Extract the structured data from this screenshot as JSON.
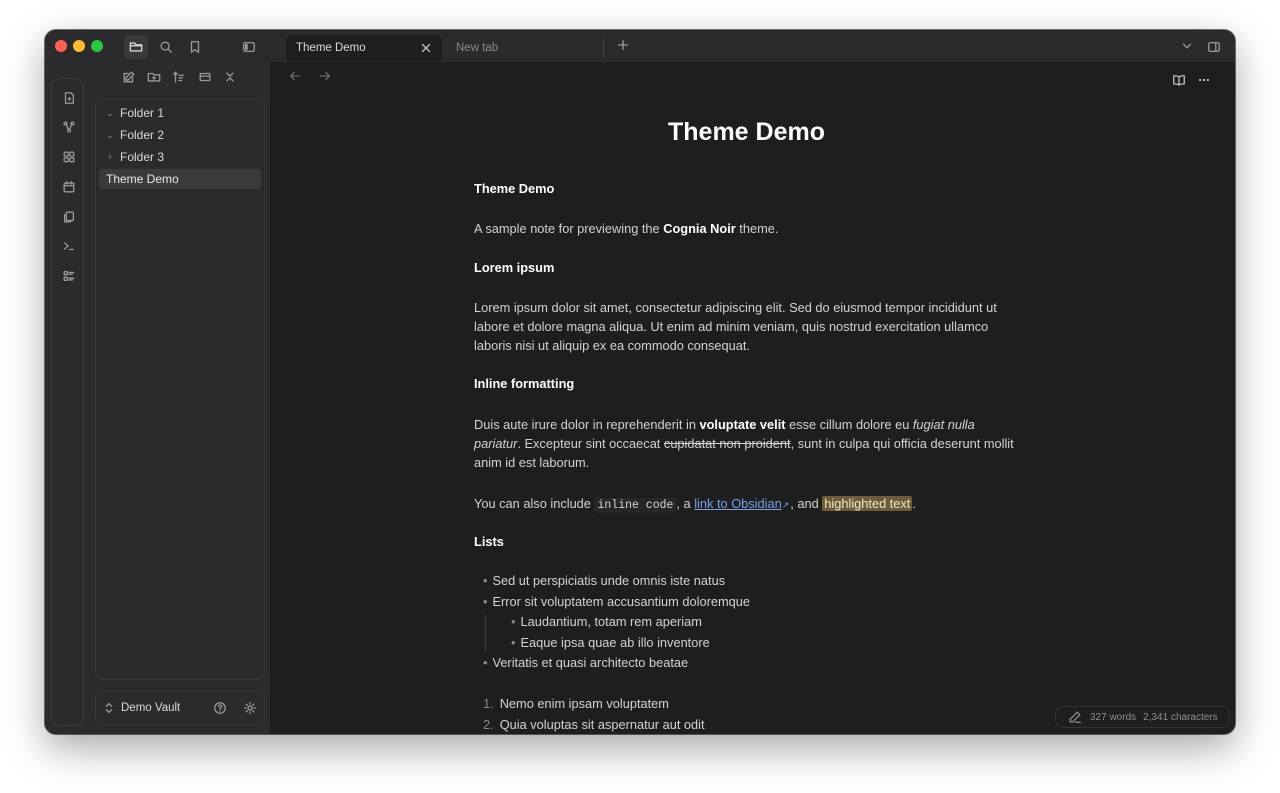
{
  "tabs": [
    {
      "label": "Theme Demo",
      "active": true
    },
    {
      "label": "New tab",
      "active": false
    }
  ],
  "file_tree": {
    "items": [
      {
        "label": "Folder 1",
        "type": "folder",
        "expanded": true
      },
      {
        "label": "Folder 2",
        "type": "folder",
        "expanded": true
      },
      {
        "label": "Folder 3",
        "type": "folder",
        "expanded": false
      },
      {
        "label": "Theme Demo",
        "type": "file",
        "selected": true
      }
    ]
  },
  "vault": {
    "name": "Demo Vault"
  },
  "note": {
    "title": "Theme Demo",
    "h_theme": "Theme Demo",
    "intro_pre": "A sample note for previewing the ",
    "intro_bold": "Cognia Noir",
    "intro_post": " theme.",
    "h_lorem": "Lorem ipsum",
    "lorem_text": "Lorem ipsum dolor sit amet, consectetur adipiscing elit. Sed do eiusmod tempor incididunt ut labore et dolore magna aliqua. Ut enim ad minim veniam, quis nostrud exercitation ullamco laboris nisi ut aliquip ex ea commodo consequat.",
    "h_inline": "Inline formatting",
    "inline1_a": "Duis aute irure dolor in reprehenderit in ",
    "inline1_bold": "voluptate velit",
    "inline1_b": " esse cillum dolore eu ",
    "inline1_italic": "fugiat nulla pariatur",
    "inline1_c": ". Excepteur sint occaecat ",
    "inline1_strike": "cupidatat non proident",
    "inline1_d": ", sunt in culpa qui officia deserunt mollit anim id est laborum.",
    "inline2_a": "You can also include ",
    "inline2_code": "inline code",
    "inline2_b": ", a ",
    "inline2_link": "link to Obsidian",
    "inline2_c": ", and ",
    "inline2_highlight": "highlighted text",
    "inline2_d": ".",
    "h_lists": "Lists",
    "bullets": [
      "Sed ut perspiciatis unde omnis iste natus",
      "Error sit voluptatem accusantium doloremque",
      "Laudantium, totam rem aperiam",
      "Eaque ipsa quae ab illo inventore",
      "Veritatis et quasi architecto beatae"
    ],
    "numbered": [
      {
        "n": "1.",
        "text": "Nemo enim ipsam voluptatem"
      },
      {
        "n": "2.",
        "text": "Quia voluptas sit aspernatur aut odit"
      }
    ]
  },
  "status_bar": {
    "words": "327 words",
    "chars": "2,341 characters"
  },
  "colors": {
    "window_bg": "#1e1e1e",
    "panel_bg": "#2b2b2d",
    "link": "#7b9fe8",
    "highlight_bg": "#6b5e39",
    "traffic_red": "#fe5f57",
    "traffic_yellow": "#febc2e",
    "traffic_green": "#28c840"
  },
  "icons": [
    "files-icon",
    "search-icon",
    "bookmark-icon",
    "sidebar-toggle-icon",
    "new-tab-plus-icon",
    "chevron-down-icon",
    "right-sidebar-icon",
    "new-note-icon",
    "new-folder-icon",
    "sort-icon",
    "collapse-all-icon",
    "close-panel-icon",
    "back-arrow-icon",
    "forward-arrow-icon",
    "reading-view-icon",
    "more-options-icon",
    "help-icon",
    "settings-icon",
    "vault-switch-icon",
    "edit-pencil-icon"
  ]
}
